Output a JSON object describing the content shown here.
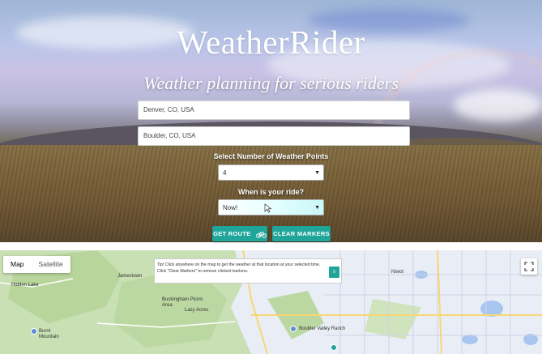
{
  "app": {
    "title": "WeatherRider",
    "subtitle": "Weather planning for serious riders"
  },
  "form": {
    "origin_value": "Denver, CO, USA",
    "destination_value": "Boulder, CO, USA",
    "points_label": "Select Number of Weather Points",
    "points_value": "4",
    "when_label": "When is your ride?",
    "when_value": "Now!",
    "get_route_label": "GET ROUTE",
    "clear_markers_label": "CLEAR MARKERS"
  },
  "map": {
    "type_options": [
      "Map",
      "Satellite"
    ],
    "selected_type": "Map",
    "tip_text": "Tip! Click anywhere on the map to get the weather at that location at your selected time. Click \"Clear Markers\" to remove clicked markers.",
    "tip_close": "x",
    "places": [
      "Hidden Lake",
      "Jamestown",
      "Buckingham Picnic Area",
      "Lazy Acres",
      "Burnt Mountain",
      "Boulder Valley Ranch",
      "Niwot"
    ],
    "route_numbers": [
      "36",
      "72",
      "119",
      "66",
      "52",
      "36",
      "119"
    ]
  },
  "colors": {
    "accent": "#1fa59a",
    "white": "#ffffff"
  }
}
